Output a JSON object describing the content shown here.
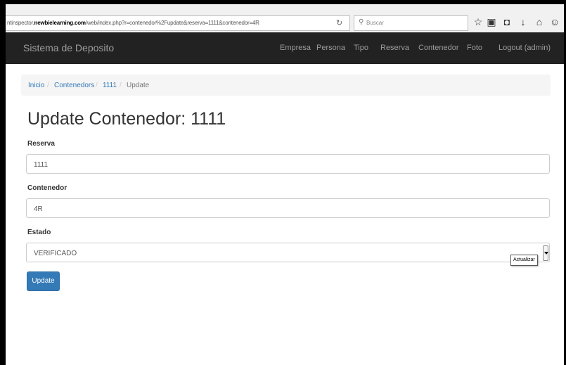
{
  "browser": {
    "url_prefix": "ntinspector.",
    "url_domain": "newbielearning.com",
    "url_path": "/web/index.php?r=contenedor%2Fupdate&reserva=1111&contenedor=4R",
    "search_placeholder": "Buscar",
    "icons": [
      "reload-icon",
      "search-icon",
      "star-icon",
      "clipboard-icon",
      "pocket-icon",
      "download-icon",
      "home-icon",
      "smiley-icon"
    ]
  },
  "navbar": {
    "brand": "Sistema de Deposito",
    "items": [
      "Empresa",
      "Persona",
      "Tipo",
      "Reserva",
      "Contenedor",
      "Foto",
      "Logout (admin)"
    ]
  },
  "breadcrumb": {
    "items": [
      "Inicio",
      "Contenedors",
      "1111"
    ],
    "separator": "/",
    "active": "Update"
  },
  "page": {
    "title": "Update Contenedor: 1111"
  },
  "form": {
    "reserva_label": "Reserva",
    "reserva_value": "1111",
    "contenedor_label": "Contenedor",
    "contenedor_value": "4R",
    "estado_label": "Estado",
    "estado_value": "VERIFICADO",
    "tooltip": "Actualizar",
    "submit_label": "Update"
  },
  "colors": {
    "navbar_bg": "#222222",
    "nav_text": "#9d9d9d",
    "link": "#337ab7",
    "button": "#337ab7"
  }
}
